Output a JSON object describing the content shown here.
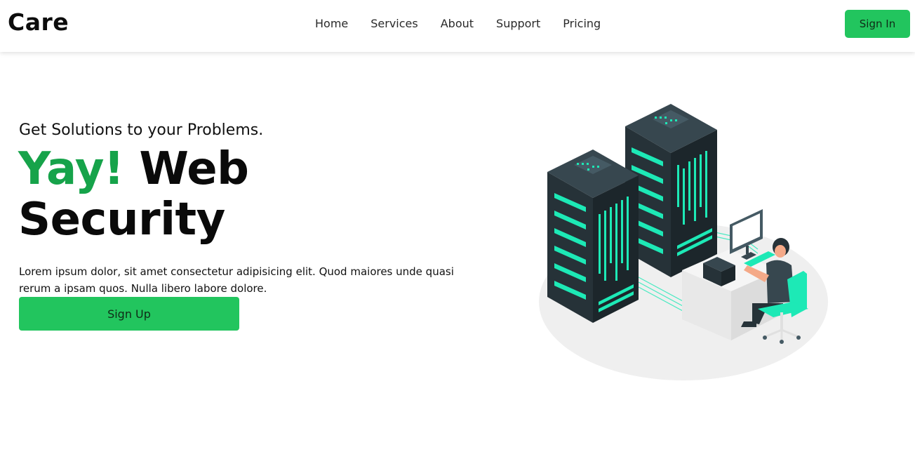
{
  "brand": {
    "name": "Care"
  },
  "nav": {
    "links": [
      "Home",
      "Services",
      "About",
      "Support",
      "Pricing"
    ],
    "signin_label": "Sign In"
  },
  "hero": {
    "subtitle": "Get Solutions to your Problems.",
    "title_accent": "Yay!",
    "title_rest": "Web Security",
    "description": "Lorem ipsum dolor, sit amet consectetur adipisicing elit. Quod maiores unde quasi rerum a ipsam quos. Nulla libero labore dolore.",
    "cta_label": "Sign Up"
  },
  "illustration": {
    "icon": "server-room-illustration"
  },
  "colors": {
    "accent": "#22c55e",
    "accent_dark": "#16a34a",
    "server": "#263238",
    "teal": "#1de9b6"
  }
}
